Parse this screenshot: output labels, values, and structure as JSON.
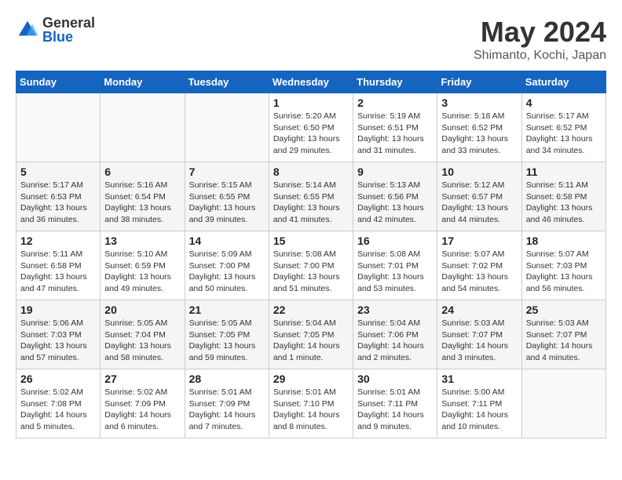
{
  "logo": {
    "general": "General",
    "blue": "Blue"
  },
  "header": {
    "month": "May 2024",
    "location": "Shimanto, Kochi, Japan"
  },
  "days_of_week": [
    "Sunday",
    "Monday",
    "Tuesday",
    "Wednesday",
    "Thursday",
    "Friday",
    "Saturday"
  ],
  "weeks": [
    [
      {
        "day": "",
        "empty": true
      },
      {
        "day": "",
        "empty": true
      },
      {
        "day": "",
        "empty": true
      },
      {
        "day": "1",
        "sunrise": "5:20 AM",
        "sunset": "6:50 PM",
        "daylight": "13 hours and 29 minutes."
      },
      {
        "day": "2",
        "sunrise": "5:19 AM",
        "sunset": "6:51 PM",
        "daylight": "13 hours and 31 minutes."
      },
      {
        "day": "3",
        "sunrise": "5:18 AM",
        "sunset": "6:52 PM",
        "daylight": "13 hours and 33 minutes."
      },
      {
        "day": "4",
        "sunrise": "5:17 AM",
        "sunset": "6:52 PM",
        "daylight": "13 hours and 34 minutes."
      }
    ],
    [
      {
        "day": "5",
        "sunrise": "5:17 AM",
        "sunset": "6:53 PM",
        "daylight": "13 hours and 36 minutes."
      },
      {
        "day": "6",
        "sunrise": "5:16 AM",
        "sunset": "6:54 PM",
        "daylight": "13 hours and 38 minutes."
      },
      {
        "day": "7",
        "sunrise": "5:15 AM",
        "sunset": "6:55 PM",
        "daylight": "13 hours and 39 minutes."
      },
      {
        "day": "8",
        "sunrise": "5:14 AM",
        "sunset": "6:55 PM",
        "daylight": "13 hours and 41 minutes."
      },
      {
        "day": "9",
        "sunrise": "5:13 AM",
        "sunset": "6:56 PM",
        "daylight": "13 hours and 42 minutes."
      },
      {
        "day": "10",
        "sunrise": "5:12 AM",
        "sunset": "6:57 PM",
        "daylight": "13 hours and 44 minutes."
      },
      {
        "day": "11",
        "sunrise": "5:11 AM",
        "sunset": "6:58 PM",
        "daylight": "13 hours and 46 minutes."
      }
    ],
    [
      {
        "day": "12",
        "sunrise": "5:11 AM",
        "sunset": "6:58 PM",
        "daylight": "13 hours and 47 minutes."
      },
      {
        "day": "13",
        "sunrise": "5:10 AM",
        "sunset": "6:59 PM",
        "daylight": "13 hours and 49 minutes."
      },
      {
        "day": "14",
        "sunrise": "5:09 AM",
        "sunset": "7:00 PM",
        "daylight": "13 hours and 50 minutes."
      },
      {
        "day": "15",
        "sunrise": "5:08 AM",
        "sunset": "7:00 PM",
        "daylight": "13 hours and 51 minutes."
      },
      {
        "day": "16",
        "sunrise": "5:08 AM",
        "sunset": "7:01 PM",
        "daylight": "13 hours and 53 minutes."
      },
      {
        "day": "17",
        "sunrise": "5:07 AM",
        "sunset": "7:02 PM",
        "daylight": "13 hours and 54 minutes."
      },
      {
        "day": "18",
        "sunrise": "5:07 AM",
        "sunset": "7:03 PM",
        "daylight": "13 hours and 56 minutes."
      }
    ],
    [
      {
        "day": "19",
        "sunrise": "5:06 AM",
        "sunset": "7:03 PM",
        "daylight": "13 hours and 57 minutes."
      },
      {
        "day": "20",
        "sunrise": "5:05 AM",
        "sunset": "7:04 PM",
        "daylight": "13 hours and 58 minutes."
      },
      {
        "day": "21",
        "sunrise": "5:05 AM",
        "sunset": "7:05 PM",
        "daylight": "13 hours and 59 minutes."
      },
      {
        "day": "22",
        "sunrise": "5:04 AM",
        "sunset": "7:05 PM",
        "daylight": "14 hours and 1 minute."
      },
      {
        "day": "23",
        "sunrise": "5:04 AM",
        "sunset": "7:06 PM",
        "daylight": "14 hours and 2 minutes."
      },
      {
        "day": "24",
        "sunrise": "5:03 AM",
        "sunset": "7:07 PM",
        "daylight": "14 hours and 3 minutes."
      },
      {
        "day": "25",
        "sunrise": "5:03 AM",
        "sunset": "7:07 PM",
        "daylight": "14 hours and 4 minutes."
      }
    ],
    [
      {
        "day": "26",
        "sunrise": "5:02 AM",
        "sunset": "7:08 PM",
        "daylight": "14 hours and 5 minutes."
      },
      {
        "day": "27",
        "sunrise": "5:02 AM",
        "sunset": "7:09 PM",
        "daylight": "14 hours and 6 minutes."
      },
      {
        "day": "28",
        "sunrise": "5:01 AM",
        "sunset": "7:09 PM",
        "daylight": "14 hours and 7 minutes."
      },
      {
        "day": "29",
        "sunrise": "5:01 AM",
        "sunset": "7:10 PM",
        "daylight": "14 hours and 8 minutes."
      },
      {
        "day": "30",
        "sunrise": "5:01 AM",
        "sunset": "7:11 PM",
        "daylight": "14 hours and 9 minutes."
      },
      {
        "day": "31",
        "sunrise": "5:00 AM",
        "sunset": "7:11 PM",
        "daylight": "14 hours and 10 minutes."
      },
      {
        "day": "",
        "empty": true
      }
    ]
  ]
}
